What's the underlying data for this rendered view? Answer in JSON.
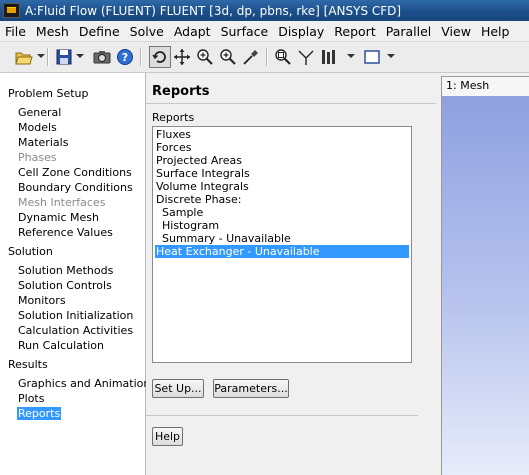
{
  "window": {
    "title": "A:Fluid Flow (FLUENT) FLUENT  [3d, dp, pbns, rke] [ANSYS CFD]"
  },
  "menubar": {
    "items": [
      "File",
      "Mesh",
      "Define",
      "Solve",
      "Adapt",
      "Surface",
      "Display",
      "Report",
      "Parallel",
      "View",
      "Help"
    ]
  },
  "toolbar": {
    "icons": [
      "open-file-icon",
      "save-icon",
      "camera-icon",
      "help-icon",
      "rotate-icon",
      "pan-icon",
      "zoom-in-icon",
      "zoom-fit-icon",
      "probe-icon",
      "zoom-box-icon",
      "axes-icon",
      "layout-icon",
      "window-icon"
    ]
  },
  "nav": {
    "sections": [
      {
        "label": "Problem Setup",
        "items": [
          {
            "label": "General",
            "state": "normal"
          },
          {
            "label": "Models",
            "state": "normal"
          },
          {
            "label": "Materials",
            "state": "normal"
          },
          {
            "label": "Phases",
            "state": "disabled"
          },
          {
            "label": "Cell Zone Conditions",
            "state": "normal"
          },
          {
            "label": "Boundary Conditions",
            "state": "normal"
          },
          {
            "label": "Mesh Interfaces",
            "state": "disabled"
          },
          {
            "label": "Dynamic Mesh",
            "state": "normal"
          },
          {
            "label": "Reference Values",
            "state": "normal"
          }
        ]
      },
      {
        "label": "Solution",
        "items": [
          {
            "label": "Solution Methods",
            "state": "normal"
          },
          {
            "label": "Solution Controls",
            "state": "normal"
          },
          {
            "label": "Monitors",
            "state": "normal"
          },
          {
            "label": "Solution Initialization",
            "state": "normal"
          },
          {
            "label": "Calculation Activities",
            "state": "normal"
          },
          {
            "label": "Run Calculation",
            "state": "normal"
          }
        ]
      },
      {
        "label": "Results",
        "items": [
          {
            "label": "Graphics and Animations",
            "state": "normal"
          },
          {
            "label": "Plots",
            "state": "normal"
          },
          {
            "label": "Reports",
            "state": "selected"
          }
        ]
      }
    ]
  },
  "task": {
    "title": "Reports",
    "list_label": "Reports",
    "reports": [
      {
        "label": "Fluxes",
        "indent": false,
        "selected": false
      },
      {
        "label": "Forces",
        "indent": false,
        "selected": false
      },
      {
        "label": "Projected Areas",
        "indent": false,
        "selected": false
      },
      {
        "label": "Surface Integrals",
        "indent": false,
        "selected": false
      },
      {
        "label": "Volume Integrals",
        "indent": false,
        "selected": false
      },
      {
        "label": "Discrete Phase:",
        "indent": false,
        "selected": false
      },
      {
        "label": "Sample",
        "indent": true,
        "selected": false
      },
      {
        "label": "Histogram",
        "indent": true,
        "selected": false
      },
      {
        "label": "Summary - Unavailable",
        "indent": true,
        "selected": false
      },
      {
        "label": "Heat Exchanger - Unavailable",
        "indent": false,
        "selected": true
      }
    ],
    "setup_button": "Set Up...",
    "parameters_button": "Parameters...",
    "help_button": "Help"
  },
  "graphics": {
    "tab_label": "1: Mesh"
  },
  "colors": {
    "selection": "#3399ff",
    "title_bar": "#1b4f8a",
    "viewport_top": "#8fa0e0",
    "viewport_bottom": "#e8ecfa"
  }
}
